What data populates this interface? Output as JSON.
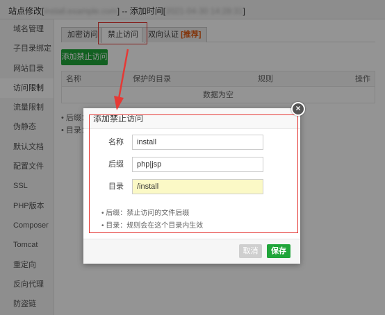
{
  "titlebar": {
    "prefix": "站点修改[",
    "blurred": "install.example.com",
    "suffix": "] -- 添加时间[",
    "blurred_time": "2021-04-30 14:28:31",
    "end": "]"
  },
  "sidebar": {
    "items": [
      {
        "label": "域名管理"
      },
      {
        "label": "子目录绑定"
      },
      {
        "label": "网站目录"
      },
      {
        "label": "访问限制",
        "active": true
      },
      {
        "label": "流量限制"
      },
      {
        "label": "伪静态"
      },
      {
        "label": "默认文档"
      },
      {
        "label": "配置文件"
      },
      {
        "label": "SSL"
      },
      {
        "label": "PHP版本"
      },
      {
        "label": "Composer"
      },
      {
        "label": "Tomcat"
      },
      {
        "label": "重定向"
      },
      {
        "label": "反向代理"
      },
      {
        "label": "防盗链"
      }
    ]
  },
  "main": {
    "tabs": {
      "t1": "加密访问",
      "t2": "禁止访问",
      "t3": "双向认证",
      "t3_badge": "[推荐]"
    },
    "add_button": "添加禁止访问",
    "table": {
      "col_name": "名称",
      "col_dir": "保护的目录",
      "col_rule": "规则",
      "col_action": "操作",
      "empty": "数据为空"
    },
    "tips": {
      "t1": "• 后缀：",
      "t2": "• 目录："
    }
  },
  "modal": {
    "title": "添加禁止访问",
    "fields": {
      "name_label": "名称",
      "name_value": "install",
      "suffix_label": "后缀",
      "suffix_value": "php|jsp",
      "dir_label": "目录",
      "dir_value": "/install"
    },
    "tips": {
      "t1": "•  后缀：禁止访问的文件后缀",
      "t2": "•  目录：规则会在这个目录内生效"
    },
    "cancel": "取消",
    "save": "保存",
    "close": "×"
  },
  "colors": {
    "accent_green": "#20a53a",
    "highlight_red": "#e53935",
    "recommend_orange": "#e05b12"
  }
}
